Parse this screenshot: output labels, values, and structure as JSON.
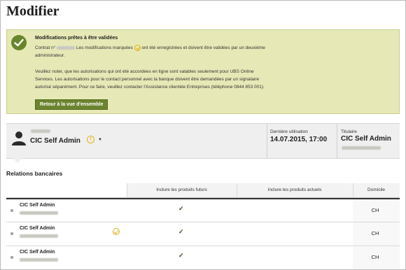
{
  "page": {
    "title": "Modifier"
  },
  "notice": {
    "title": "Modifications prêtes à être validées",
    "line1_prefix": "Contrat n°",
    "line1_suffix": "Les modifications marquées",
    "line1_end": "ont été enregistrées et doivent être validées par un deuxième",
    "line2": "administrateur.",
    "para2_line1": "Veuillez noter, que les autorisations qui ont été accordées en ligne sont valables seulement pour UBS Online",
    "para2_line2": "Services. Les autorisations pour le contact personnel avec la banque doivent être demandées par un signataire",
    "para2_line3": "autorisé séparément. Pour ce faire, veuillez contacter l'Assistance clientèle Entreprises (téléphone 0844 853 001).",
    "button_label": "Retour à la vue d'ensemble"
  },
  "user_bar": {
    "name": "CIC Self Admin",
    "warn_glyph": "!",
    "caret_glyph": "▼",
    "last_use_label": "Dernière utilisation",
    "last_use_value": "14.07.2015, 17:00",
    "holder_label": "Titulaire",
    "holder_value": "CIC Self Admin"
  },
  "relations": {
    "title": "Relations bancaires",
    "columns": [
      "Inclure les produits futurs",
      "Inclure les produits actuels",
      "Domicile"
    ],
    "rows": [
      {
        "name": "CIC Self Admin",
        "future": "✓",
        "current": "",
        "domicile": "CH",
        "pending": false
      },
      {
        "name": "CIC Self Admin",
        "future": "✓",
        "current": "",
        "domicile": "CH",
        "pending": true
      },
      {
        "name": "CIC Self Admin",
        "future": "✓",
        "current": "",
        "domicile": "CH",
        "pending": false
      }
    ]
  },
  "colors": {
    "accent_green": "#6c8430",
    "notice_bg": "#e6e9b6",
    "warning": "#e3b012"
  }
}
